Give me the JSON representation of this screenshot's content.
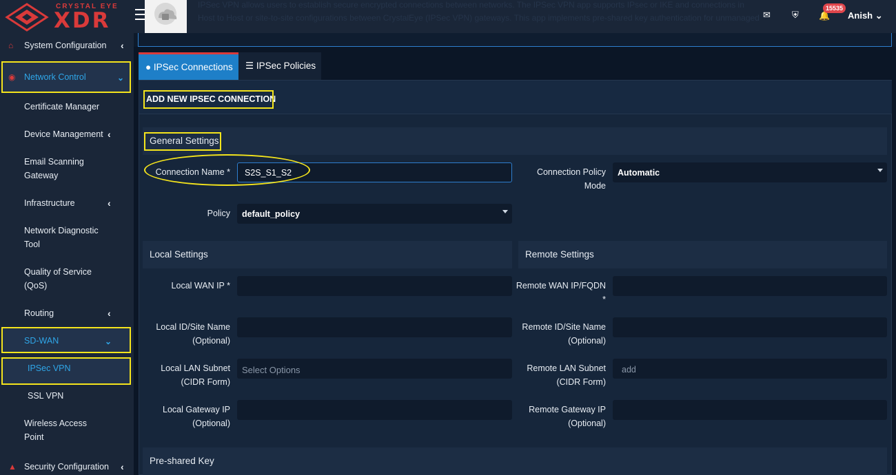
{
  "brand": {
    "small": "CRYSTAL EYE",
    "big": "XDR"
  },
  "header": {
    "description": "IPSec VPN allows users to establish secure encrypted connections between networks. The IPSec VPN app supports IPsec or IKE and connections in Host to Host or site-to-site configurations between CrystalEye (IPSec VPN) gateways. This app implements pre-shared key authentication for unmanaged static connections only.",
    "notification_count": "15535",
    "user_name": "Anish"
  },
  "sidebar": {
    "items": [
      {
        "label": "System Configuration"
      },
      {
        "label": "Network Control"
      },
      {
        "label": "Certificate Manager"
      },
      {
        "label": "Device Management"
      },
      {
        "label_line1": "Email Scanning",
        "label_line2": "Gateway"
      },
      {
        "label": "Infrastructure"
      },
      {
        "label_line1": "Network Diagnostic",
        "label_line2": "Tool"
      },
      {
        "label_line1": "Quality of Service",
        "label_line2": "(QoS)"
      },
      {
        "label": "Routing"
      },
      {
        "label": "SD-WAN"
      },
      {
        "label": "IPSec VPN"
      },
      {
        "label": "SSL VPN"
      },
      {
        "label_line1": "Wireless Access",
        "label_line2": "Point"
      },
      {
        "label": "Security Configuration"
      }
    ]
  },
  "tabs": [
    {
      "label": "IPSec Connections"
    },
    {
      "label": "IPSec Policies"
    }
  ],
  "panel": {
    "title": "ADD NEW IPSEC CONNECTION",
    "general_settings": "General Settings",
    "connection_name_label": "Connection Name *",
    "connection_name_value": "S2S_S1_S2",
    "connection_policy_mode_label_line1": "Connection Policy",
    "connection_policy_mode_label_line2": "Mode",
    "connection_policy_mode_value": "Automatic",
    "policy_label": "Policy",
    "policy_value": "default_policy",
    "local_settings": "Local Settings",
    "remote_settings": "Remote Settings",
    "local_wan_ip_label": "Local WAN IP *",
    "remote_wan_label_line1": "Remote WAN IP/FQDN",
    "remote_wan_label_line2": "*",
    "local_id_label_line1": "Local ID/Site Name",
    "local_id_label_line2": "(Optional)",
    "remote_id_label_line1": "Remote ID/Site Name",
    "remote_id_label_line2": "(Optional)",
    "local_lan_label_line1": "Local LAN Subnet",
    "local_lan_label_line2": "(CIDR Form)",
    "local_lan_placeholder": "Select Options",
    "remote_lan_label_line1": "Remote LAN Subnet",
    "remote_lan_label_line2": "(CIDR Form)",
    "remote_lan_placeholder": "add",
    "local_gw_label_line1": "Local Gateway IP",
    "local_gw_label_line2": "(Optional)",
    "remote_gw_label_line1": "Remote Gateway IP",
    "remote_gw_label_line2": "(Optional)",
    "preshared_key": "Pre-shared Key"
  },
  "colors": {
    "accent_blue": "#2fa6e8",
    "brand_red": "#d93a3a",
    "highlight_yellow": "#f5e51c",
    "tab_active": "#1e7fc8"
  }
}
